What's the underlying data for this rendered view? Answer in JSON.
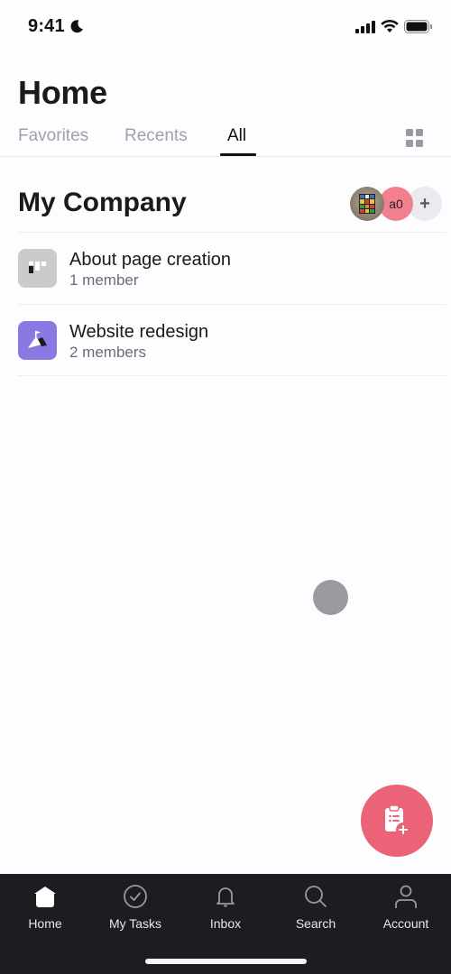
{
  "status_bar": {
    "time": "9:41",
    "focus_icon": "moon-icon",
    "icons": [
      "cellular-signal-icon",
      "wifi-icon",
      "battery-icon"
    ]
  },
  "header": {
    "title": "Home",
    "tabs": [
      {
        "label": "Favorites",
        "active": false
      },
      {
        "label": "Recents",
        "active": false
      },
      {
        "label": "All",
        "active": true
      }
    ],
    "view_toggle_icon": "grid-icon"
  },
  "workspace": {
    "title": "My Company",
    "avatars": [
      {
        "type": "photo",
        "description": "rubiks-cube-photo"
      },
      {
        "type": "initials",
        "initials": "a0",
        "color": "#f3808f"
      },
      {
        "type": "add",
        "label": "+"
      }
    ]
  },
  "projects": [
    {
      "name": "About page creation",
      "members": "1 member",
      "icon": "board-icon",
      "color": "#cbcacd"
    },
    {
      "name": "Website redesign",
      "members": "2 members",
      "icon": "mountain-flag-icon",
      "color": "#8b78e3"
    }
  ],
  "fab": {
    "icon": "add-task-clipboard-icon",
    "color": "#ea6378"
  },
  "bottom_nav": {
    "items": [
      {
        "label": "Home",
        "icon": "home-icon",
        "active": true
      },
      {
        "label": "My Tasks",
        "icon": "check-circle-icon",
        "active": false
      },
      {
        "label": "Inbox",
        "icon": "bell-icon",
        "active": false
      },
      {
        "label": "Search",
        "icon": "search-icon",
        "active": false
      },
      {
        "label": "Account",
        "icon": "person-icon",
        "active": false
      }
    ]
  }
}
